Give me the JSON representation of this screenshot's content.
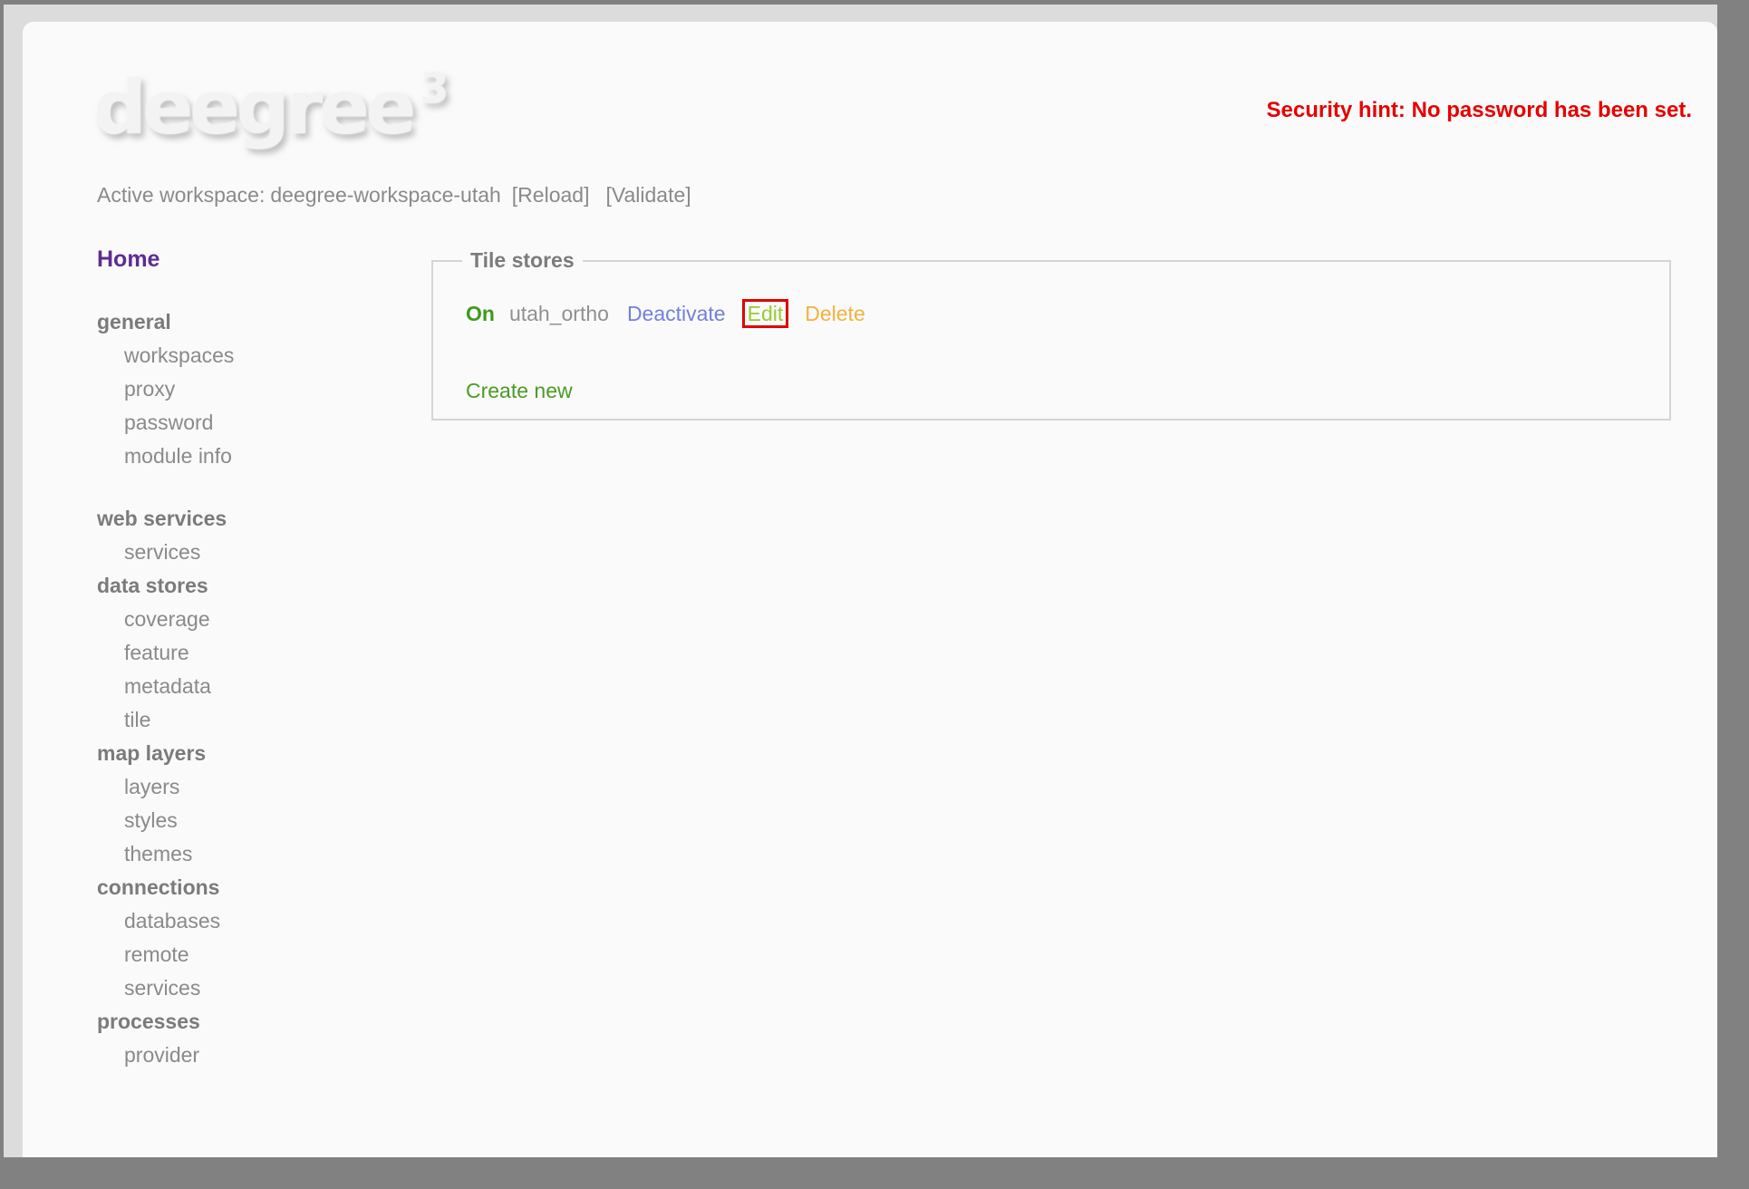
{
  "header": {
    "logo_text": "deegree",
    "logo_sup": "3",
    "security_hint": "Security hint: No password has been set.",
    "workspace_label": "Active workspace:",
    "workspace_name": "deegree-workspace-utah",
    "reload_label": "[Reload]",
    "validate_label": "[Validate]"
  },
  "sidebar": {
    "home_label": "Home",
    "groups": [
      {
        "label": "general",
        "gap_before": true,
        "items": [
          "workspaces",
          "proxy",
          "password",
          "module info"
        ]
      },
      {
        "label": "web services",
        "gap_before": true,
        "items": [
          "services"
        ]
      },
      {
        "label": "data stores",
        "gap_before": false,
        "items": [
          "coverage",
          "feature",
          "metadata",
          "tile"
        ]
      },
      {
        "label": "map layers",
        "gap_before": false,
        "items": [
          "layers",
          "styles",
          "themes"
        ]
      },
      {
        "label": "connections",
        "gap_before": false,
        "items": [
          "databases",
          "remote",
          "services"
        ]
      },
      {
        "label": "processes",
        "gap_before": false,
        "items": [
          "provider"
        ]
      }
    ]
  },
  "main": {
    "panel_title": "Tile stores",
    "rows": [
      {
        "status": "On",
        "name": "utah_ortho",
        "actions": [
          {
            "label": "Deactivate",
            "color": "#7380da",
            "highlighted": false
          },
          {
            "label": "Edit",
            "color": "#95cd31",
            "highlighted": true
          },
          {
            "label": "Delete",
            "color": "#f4b13c",
            "highlighted": false
          }
        ]
      }
    ],
    "create_new_label": "Create new"
  },
  "colors": {
    "frame": "#818181",
    "page_bg": "#dcdcdc",
    "card_bg": "#fafafa",
    "text_gray": "#8a8a8a",
    "heading_gray": "#7b7b7b",
    "home_purple": "#5c2d91",
    "security_red": "#e60000",
    "status_on": "#3f9a1a",
    "create_new": "#4a9b24",
    "highlight_box": "#e00000",
    "panel_border": "#d4d4d4"
  }
}
